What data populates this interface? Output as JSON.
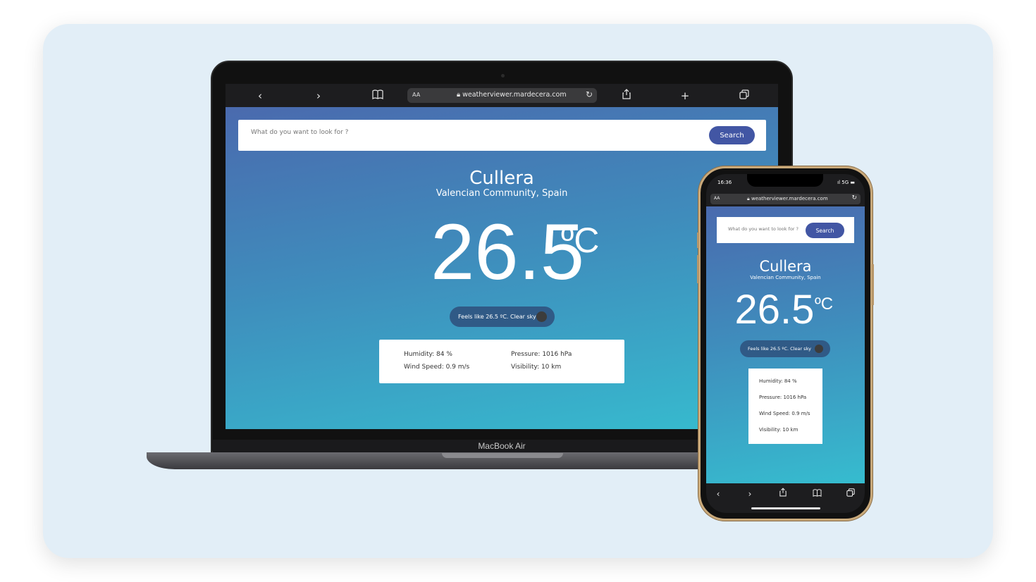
{
  "device_label": "MacBook Air",
  "browser": {
    "aa_label": "AA",
    "url": "weatherviewer.mardecera.com",
    "icons": [
      "back-icon",
      "forward-icon",
      "bookmarks-icon",
      "share-icon",
      "new-tab-icon",
      "tabs-icon",
      "reload-icon",
      "lock-icon"
    ]
  },
  "phone_status": {
    "time": "16:36",
    "signal": "5G"
  },
  "search": {
    "placeholder": "What do you want to look for ?",
    "button_label": "Search"
  },
  "weather": {
    "city": "Cullera",
    "region": "Valencian Community, Spain",
    "temperature": "26.5",
    "unit": "ºC",
    "feels_like": "Feels like 26.5 ºC. Clear sky",
    "humidity": "Humidity: 84 %",
    "pressure": "Pressure: 1016 hPa",
    "wind_speed": "Wind Speed: 0.9 m/s",
    "visibility": "Visibility: 10 km"
  },
  "colors": {
    "background_card": "#e2eef7",
    "gradient_top": "#4a6aae",
    "gradient_bottom": "#36bccf",
    "search_button": "#4256a4",
    "feels_pill": "#305a86",
    "phone_frame": "#c9a97a"
  }
}
